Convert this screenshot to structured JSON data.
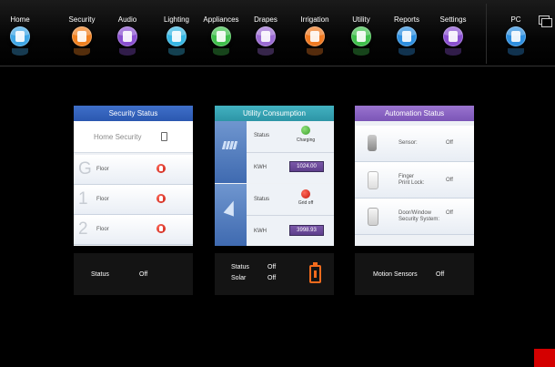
{
  "nav": {
    "items": [
      {
        "label": "Home",
        "icon": "home-icon",
        "color": "#3fa7e6"
      },
      {
        "label": "Security",
        "icon": "shield-icon",
        "color": "#f0801f"
      },
      {
        "label": "Audio",
        "icon": "music-note-icon",
        "color": "#8a4fd0"
      },
      {
        "label": "Lighting",
        "icon": "lightbulb-icon",
        "color": "#36b7e4"
      },
      {
        "label": "Appliances",
        "icon": "appliance-icon",
        "color": "#3fbf4b"
      },
      {
        "label": "Drapes",
        "icon": "drapes-icon",
        "color": "#9b6bd3"
      },
      {
        "label": "Irrigation",
        "icon": "watering-can-icon",
        "color": "#f07a22"
      },
      {
        "label": "Utility",
        "icon": "plug-icon",
        "color": "#3fbf4b"
      },
      {
        "label": "Reports",
        "icon": "document-icon",
        "color": "#2d8fe0"
      },
      {
        "label": "Settings",
        "icon": "gear-icon",
        "color": "#8a4fd0"
      },
      {
        "label": "PC",
        "icon": "monitor-icon",
        "color": "#2d8fe0"
      }
    ]
  },
  "security": {
    "title": "Security Status",
    "home_label": "Home Security",
    "floors": [
      {
        "num": "G",
        "label": "Floor"
      },
      {
        "num": "1",
        "label": "Floor"
      },
      {
        "num": "2",
        "label": "Floor"
      }
    ],
    "footer": {
      "label": "Status",
      "value": "Off"
    }
  },
  "utility": {
    "title": "Utility Consumption",
    "solar": {
      "status_label": "Status",
      "status_text": "Charging",
      "kwh_label": "KWH",
      "kwh_value": "1024.00"
    },
    "grid": {
      "status_label": "Status",
      "status_text": "Grid off",
      "kwh_label": "KWH",
      "kwh_value": "3998.93"
    },
    "footer": {
      "status_label": "Status",
      "status_value": "Off",
      "solar_label": "Solar",
      "solar_value": "Off"
    }
  },
  "automation": {
    "title": "Automation Status",
    "rows": [
      {
        "label": "Sensor:",
        "value": "Off"
      },
      {
        "label": "Finger\nPrint Lock:",
        "value": "Off"
      },
      {
        "label": "Door/Window\nSecurity System:",
        "value": "Off"
      }
    ],
    "footer": {
      "label": "Motion Sensors",
      "value": "Off"
    }
  },
  "colors": {
    "security_head": "#3262bd",
    "utility_head": "#36a3b3",
    "automation_head": "#8a63c2",
    "alert": "#d22a1a",
    "battery": "#f26b1d"
  }
}
